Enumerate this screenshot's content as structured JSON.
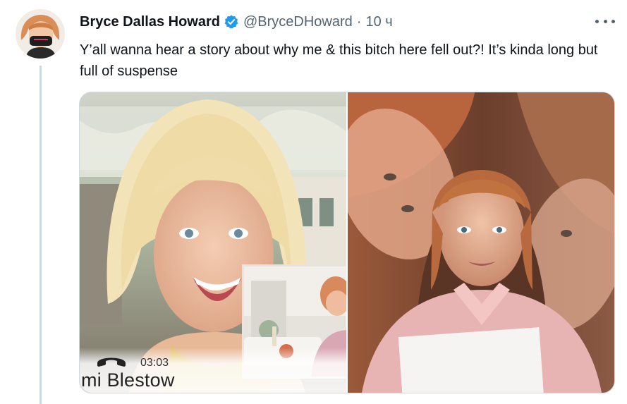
{
  "tweet": {
    "author_name": "Bryce Dallas Howard",
    "handle": "@BryceDHoward",
    "separator": "·",
    "time": "10 ч",
    "text": "Y’all wanna hear a story about why me & this bitch here fell out?! It’s kinda long but full of suspense"
  },
  "media": {
    "left_photo": {
      "call_timer": "03:03",
      "caller_name": "mi Blestow"
    }
  },
  "colors": {
    "text_primary": "#0f1419",
    "text_secondary": "#536471",
    "verified_blue": "#1d9bf0",
    "border": "#cfd9de"
  },
  "icons": {
    "verified": "verified-badge-icon",
    "more": "more-options-icon",
    "phone": "phone-hangup-icon"
  }
}
